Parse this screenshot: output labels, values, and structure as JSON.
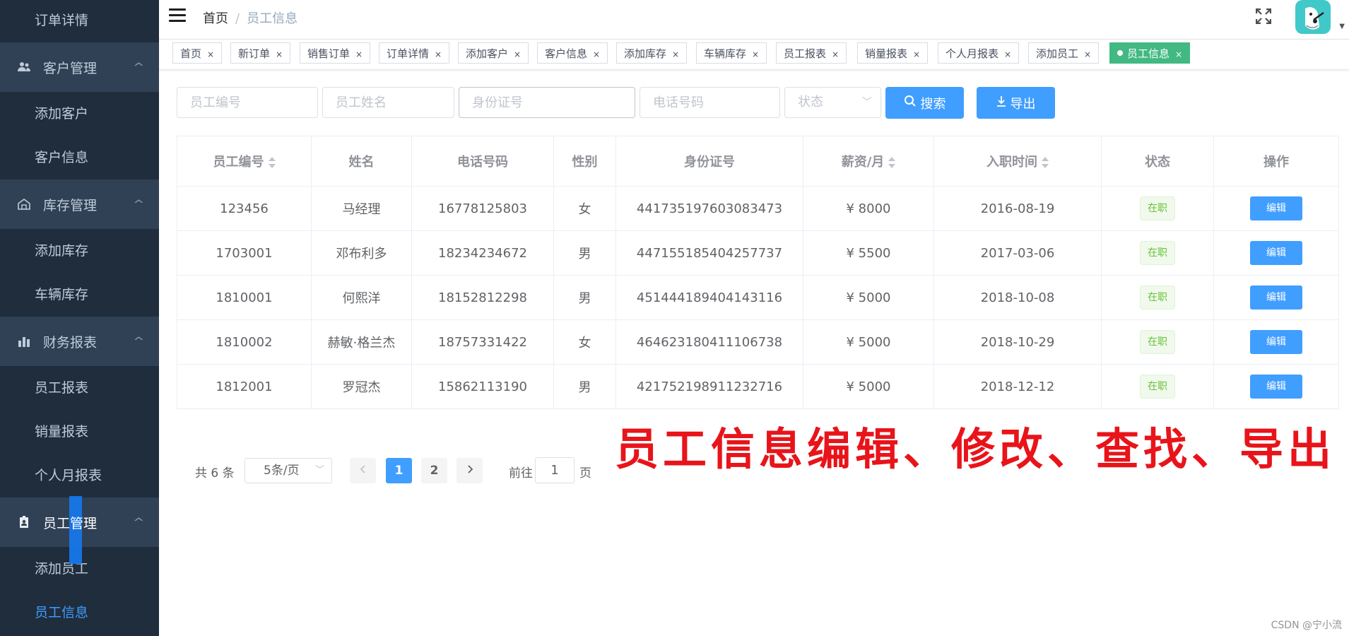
{
  "sidebar": {
    "items": [
      {
        "type": "sub",
        "label": "订单详情",
        "active": false
      },
      {
        "type": "group",
        "label": "客户管理",
        "icon": "users-icon"
      },
      {
        "type": "sub",
        "label": "添加客户",
        "active": false
      },
      {
        "type": "sub",
        "label": "客户信息",
        "active": false
      },
      {
        "type": "group",
        "label": "库存管理",
        "icon": "warehouse-icon"
      },
      {
        "type": "sub",
        "label": "添加库存",
        "active": false
      },
      {
        "type": "sub",
        "label": "车辆库存",
        "active": false
      },
      {
        "type": "group",
        "label": "财务报表",
        "icon": "bar-chart-icon"
      },
      {
        "type": "sub",
        "label": "员工报表",
        "active": false
      },
      {
        "type": "sub",
        "label": "销量报表",
        "active": false
      },
      {
        "type": "sub",
        "label": "个人月报表",
        "active": false
      },
      {
        "type": "group",
        "label": "员工管理",
        "icon": "id-badge-icon"
      },
      {
        "type": "sub",
        "label": "添加员工",
        "active": false
      },
      {
        "type": "sub",
        "label": "员工信息",
        "active": true
      }
    ]
  },
  "header": {
    "breadcrumb_home": "首页",
    "breadcrumb_sep": "/",
    "breadcrumb_current": "员工信息"
  },
  "tags": [
    "首页",
    "新订单",
    "销售订单",
    "订单详情",
    "添加客户",
    "客户信息",
    "添加库存",
    "车辆库存",
    "员工报表",
    "销量报表",
    "个人月报表",
    "添加员工",
    "员工信息"
  ],
  "tag_close": "×",
  "filters": {
    "emp_id_placeholder": "员工编号",
    "name_placeholder": "员工姓名",
    "id_card_placeholder": "身份证号",
    "phone_placeholder": "电话号码",
    "status_placeholder": "状态",
    "search_label": "搜索",
    "export_label": "导出"
  },
  "table": {
    "headers": [
      "员工编号",
      "姓名",
      "电话号码",
      "性别",
      "身份证号",
      "薪资/月",
      "入职时间",
      "状态",
      "操作"
    ],
    "rows": [
      {
        "id": "123456",
        "name": "马经理",
        "phone": "16778125803",
        "gender": "女",
        "id_card": "441735197603083473",
        "salary": "¥ 8000",
        "date": "2016-08-19",
        "status": "在职",
        "action": "编辑"
      },
      {
        "id": "1703001",
        "name": "邓布利多",
        "phone": "18234234672",
        "gender": "男",
        "id_card": "447155185404257737",
        "salary": "¥ 5500",
        "date": "2017-03-06",
        "status": "在职",
        "action": "编辑"
      },
      {
        "id": "1810001",
        "name": "何熙洋",
        "phone": "18152812298",
        "gender": "男",
        "id_card": "451444189404143116",
        "salary": "¥ 5000",
        "date": "2018-10-08",
        "status": "在职",
        "action": "编辑"
      },
      {
        "id": "1810002",
        "name": "赫敏·格兰杰",
        "phone": "18757331422",
        "gender": "女",
        "id_card": "464623180411106738",
        "salary": "¥ 5000",
        "date": "2018-10-29",
        "status": "在职",
        "action": "编辑"
      },
      {
        "id": "1812001",
        "name": "罗冠杰",
        "phone": "15862113190",
        "gender": "男",
        "id_card": "421752198911232716",
        "salary": "¥ 5000",
        "date": "2018-12-12",
        "status": "在职",
        "action": "编辑"
      }
    ]
  },
  "pagination": {
    "total": "共 6 条",
    "page_size": "5条/页",
    "pages": [
      "1",
      "2"
    ],
    "current": "1",
    "goto_label": "前往",
    "goto_value": "1",
    "page_suffix": "页"
  },
  "annotation": "员工信息编辑、修改、查找、导出",
  "watermark": "CSDN @宁小流",
  "colors": {
    "sidebar_bg": "#1f2d3d",
    "group_bg": "#304156",
    "primary": "#409eff",
    "active_tag": "#42b983",
    "annotation": "#e8141a"
  }
}
